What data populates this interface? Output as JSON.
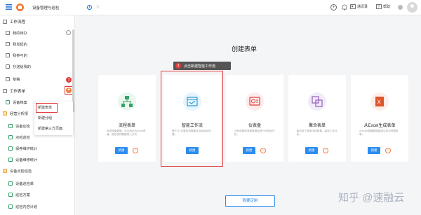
{
  "topbar": {
    "title": "设备管理与巡检",
    "contacts": "通讯录",
    "help": "帮助"
  },
  "sidebar": {
    "items": [
      {
        "label": "工作流程",
        "type": "section"
      },
      {
        "label": "我的待办"
      },
      {
        "label": "我发起的"
      },
      {
        "label": "我参与的"
      },
      {
        "label": "抄送给我的"
      },
      {
        "label": "草稿"
      },
      {
        "label": "工作表单",
        "type": "section"
      },
      {
        "label": "设备档案"
      },
      {
        "label": "经营分析报"
      },
      {
        "label": "设备动态"
      },
      {
        "label": "点检巡检"
      },
      {
        "label": "保养维护统计"
      },
      {
        "label": "设备维修统计"
      },
      {
        "label": "设备点检巡检",
        "type": "section"
      },
      {
        "label": "设备巡检单"
      },
      {
        "label": "巡检方案"
      },
      {
        "label": "巡检内容计划"
      }
    ],
    "badges": {
      "top": "1",
      "bottom": "2"
    }
  },
  "dropdown": {
    "options": [
      "新建表单",
      "新建分组",
      "新建第三方页面"
    ]
  },
  "main": {
    "title": "创建表单",
    "tooltip": "点击新建智能工作流",
    "tooltip_number": "3",
    "cards": [
      {
        "name": "流程表单",
        "desc": "用来收集数据，可以转化为Excel表格，提供多种数据录入方式",
        "button": "新建",
        "icon": "flow-icon",
        "color": "#38a169"
      },
      {
        "name": "智能工作流",
        "desc": "基于 AI 引擎的流程事件自动自动处理。",
        "button": "新建",
        "icon": "calendar-icon",
        "color": "#2d9cdb"
      },
      {
        "name": "仪表盘",
        "desc": "分析收集的表单数据及进行可视化分析。",
        "button": "新建",
        "icon": "dashboard-icon",
        "color": "#e23b3b"
      },
      {
        "name": "聚合表单",
        "desc": "聚合多个表单字段数据，高效汇总分析。",
        "button": "新建",
        "icon": "merge-icon",
        "color": "#8e5fb5"
      },
      {
        "name": "从Excel生成表单",
        "desc": "从Excel表格数据直接生成为流程表单。",
        "button": "新建",
        "icon": "excel-icon",
        "color": "#e0542a"
      }
    ],
    "custom_button": "我要定制"
  },
  "watermark": "知乎 @速融云"
}
